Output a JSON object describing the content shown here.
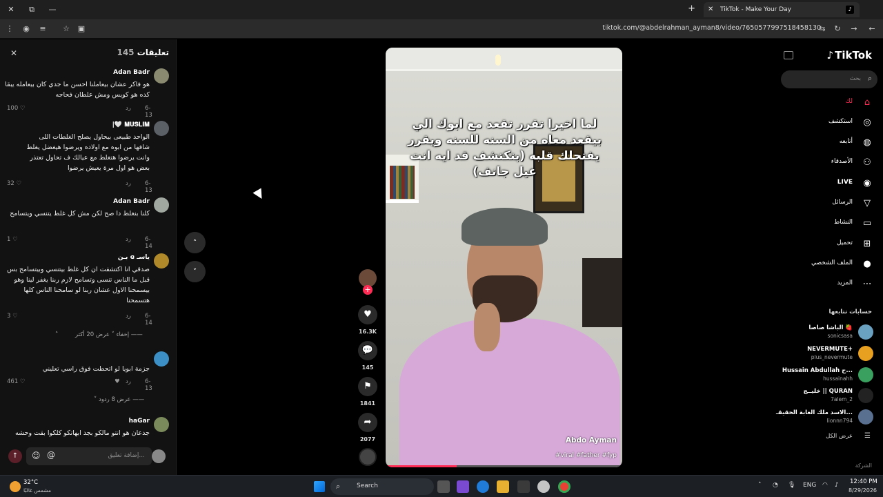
{
  "browser": {
    "tab_title": "TikTok - Make Your Day",
    "tab_favicon": "tiktok-icon",
    "url": "tiktok.com/@abdelrahman_ayman8/video/7650577997518458130"
  },
  "comments_panel": {
    "title": "تعليقات",
    "count": "145",
    "comments": [
      {
        "author": "Adan Badr",
        "text": "هو فاكر عشان بيعاملنا احسن ما جدي كان بيعامله يبقا كده هو كويس ومش علطان فحاجه",
        "date": "6-13",
        "reply": "رد",
        "likes": "100"
      },
      {
        "author": "𝐌𝐔𝐒𝐋𝐈𝐌 🤍|",
        "text": "الواحد طبيعى بيحاول يصلح الغلطات اللى شافها من ابوه مع اولاده ويرضوا هيغضل يغلط وانت يرضوا هتغلط مع عيالك ف تحاول تعتذر بعض هو اول مرة يعيش يرضوا",
        "date": "6-13",
        "reply": "رد",
        "likes": "32"
      },
      {
        "author": "Adan Badr",
        "text": "كلنا بنغلط دا صح لكن مش كل غلط يتنسي ويتسامح",
        "date": "6-14",
        "reply": "رد",
        "likes": "1"
      },
      {
        "author": "ياسـ ɞ بـن",
        "text": "صدقي انا اكتشفت ان كل غلط بيتنسي وبيتسامح بس قبل ما الناس تنسى وتسامح لازم ربنا يغفر لينا وهو بيسمحنا الاول عشان ربنا لو سامحنا الناس كلها هتسمحنا",
        "date": "6-14",
        "reply": "رد",
        "likes": "3"
      }
    ],
    "expand": {
      "more": "عرض 20 أكثر",
      "hide": "إخفاء"
    },
    "comment5": {
      "author": "",
      "text": "جزمة ابويا لو اتحطت فوق راسي تعليني",
      "date": "6-13",
      "reply": "رد",
      "likes": "461"
    },
    "expand2": "عرض 8 ردود",
    "comment6": {
      "author": "haGar",
      "text": "جدعان هو انتو مالكو بجد ابهاتكو كلكوا بقت وحشه"
    },
    "input_placeholder": "إضافة تعليق..."
  },
  "video": {
    "caption": "لما اخيرا تقرر تقعد مع ابوك الي بيقعد معاه من السنه للسنه ويقرر يفتحلك قلبه (بتكتشف قد ايه انت عيل جانف)",
    "author_name": "Abdo Ayman",
    "hashtags": "#viral #father #fyp",
    "progress": 0.3
  },
  "actions": {
    "likes": "16.3K",
    "comments": "145",
    "saves": "1841",
    "shares": "2077"
  },
  "sidebar": {
    "logo": "TikTok",
    "search_placeholder": "بحث",
    "nav": [
      {
        "label": "لك",
        "icon": "home-icon"
      },
      {
        "label": "استكشف",
        "icon": "compass-icon"
      },
      {
        "label": "أتابعه",
        "icon": "following-icon"
      },
      {
        "label": "الأصدقاء",
        "icon": "friends-icon"
      },
      {
        "label": "LIVE",
        "icon": "live-icon"
      },
      {
        "label": "الرسائل",
        "icon": "send-icon"
      },
      {
        "label": "النشاط",
        "icon": "activity-icon"
      },
      {
        "label": "تحميل",
        "icon": "upload-icon"
      },
      {
        "label": "الملف الشخصي",
        "icon": "profile-icon"
      },
      {
        "label": "المزيد",
        "icon": "more-icon"
      }
    ],
    "following_title": "حسابات تتابعها",
    "accounts": [
      {
        "name": "الباشا صاصا 🍓",
        "handle": "sonicsasa"
      },
      {
        "name": "NEVERMUTE+",
        "handle": "plus_nevermute"
      },
      {
        "name": "Hussain Abdullah ح...",
        "handle": "hussainahh"
      },
      {
        "name": "خليــج || QURAN",
        "handle": "7alem_2"
      },
      {
        "name": "الاسد ملك الغابة الحقيقـ...",
        "handle": "lionnn794"
      }
    ],
    "see_all": "عرض الكل",
    "company": "الشركة"
  },
  "taskbar": {
    "temp": "32°C",
    "weather": "مشمس غالبًا",
    "search": "Search",
    "lang": "ENG",
    "time": "12:40 PM",
    "date": "8/29/2026"
  }
}
